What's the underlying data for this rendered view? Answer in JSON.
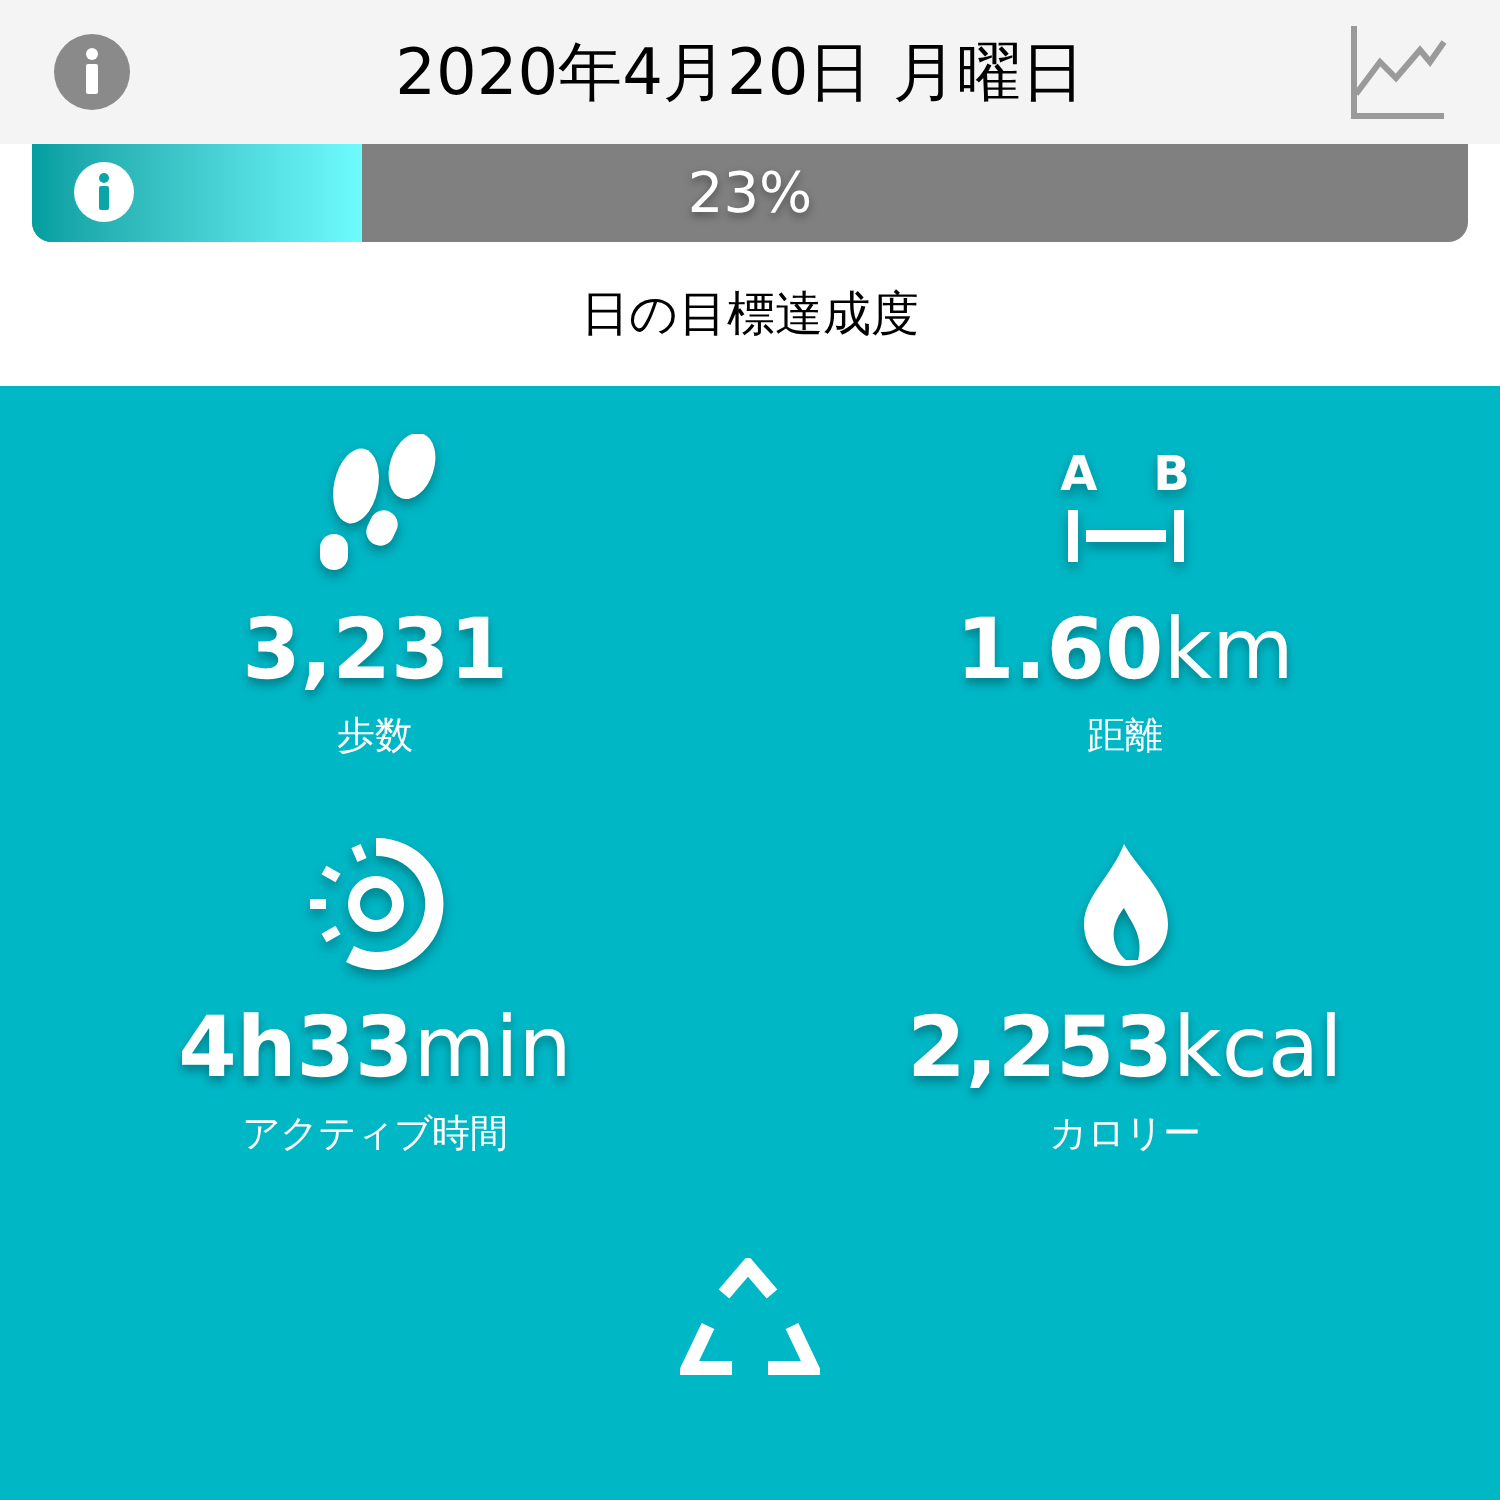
{
  "header": {
    "title": "2020年4月20日 月曜日"
  },
  "goal": {
    "level": 0.23,
    "reading": "23%",
    "label": "日の目標達成度"
  },
  "distance_icon": {
    "letters": [
      "A",
      "B"
    ]
  },
  "stats": [
    {
      "kind": "steps",
      "value": "3,231",
      "label": "歩数"
    },
    {
      "kind": "distance",
      "value": "1.60",
      "unit": "km",
      "label": "距離"
    },
    {
      "kind": "active",
      "value": "4h33",
      "unit": "min",
      "label": "アクティブ時間"
    },
    {
      "kind": "calories",
      "value": "2,253",
      "unit": "kcal",
      "label": "カロリー"
    }
  ]
}
